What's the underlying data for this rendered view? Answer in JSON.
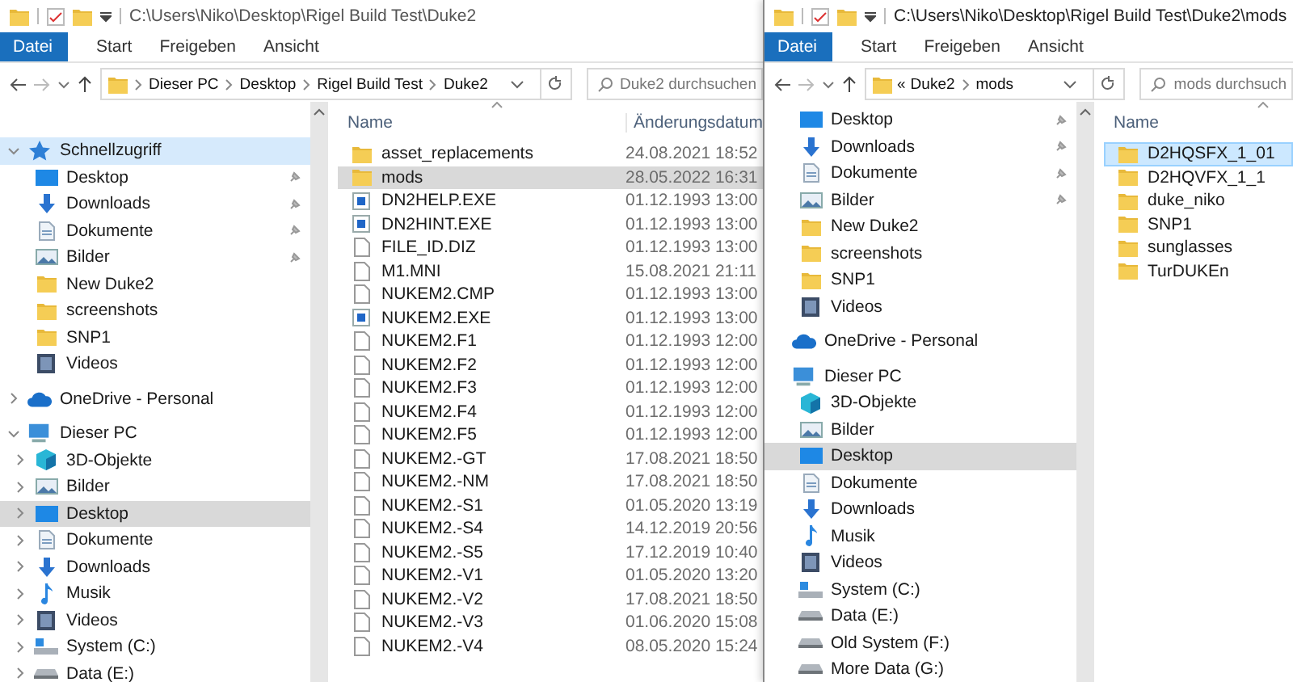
{
  "windows": [
    {
      "title_path": "C:\\Users\\Niko\\Desktop\\Rigel Build Test\\Duke2",
      "active": false,
      "chevrons_visible": true,
      "ribbon_tabs": [
        {
          "label": "Datei",
          "kind": "file_menu"
        },
        {
          "label": "Start",
          "kind": "tab"
        },
        {
          "label": "Freigeben",
          "kind": "tab"
        },
        {
          "label": "Ansicht",
          "kind": "tab"
        }
      ],
      "breadcrumb": {
        "segments": [
          "Dieser PC",
          "Desktop",
          "Rigel Build Test",
          "Duke2"
        ]
      },
      "search": {
        "placeholder": "Duke2 durchsuchen"
      },
      "sidebar": [
        {
          "label": "Schnellzugriff",
          "kind": "star",
          "expanded": true,
          "hovered": true,
          "children": [
            {
              "label": "Desktop",
              "kind": "desktop",
              "pinned": true,
              "selected": false
            },
            {
              "label": "Downloads",
              "kind": "downloads",
              "pinned": true,
              "selected": false
            },
            {
              "label": "Dokumente",
              "kind": "documents",
              "pinned": true,
              "selected": false
            },
            {
              "label": "Bilder",
              "kind": "pictures",
              "pinned": true,
              "selected": false
            },
            {
              "label": "New Duke2",
              "kind": "folder",
              "pinned": false,
              "selected": false
            },
            {
              "label": "screenshots",
              "kind": "folder",
              "pinned": false,
              "selected": false
            },
            {
              "label": "SNP1",
              "kind": "folder",
              "pinned": false,
              "selected": false
            },
            {
              "label": "Videos",
              "kind": "videos",
              "pinned": false,
              "selected": false
            }
          ]
        },
        {
          "label": "OneDrive - Personal",
          "kind": "cloud",
          "expanded": false,
          "hovered": false
        },
        {
          "label": "Dieser PC",
          "kind": "pc",
          "expanded": true,
          "hovered": false,
          "children": [
            {
              "label": "3D-Objekte",
              "kind": "objects3d",
              "pinned": false,
              "selected": false
            },
            {
              "label": "Bilder",
              "kind": "pictures",
              "pinned": false,
              "selected": false
            },
            {
              "label": "Desktop",
              "kind": "desktop",
              "pinned": false,
              "selected": true
            },
            {
              "label": "Dokumente",
              "kind": "documents",
              "pinned": false,
              "selected": false
            },
            {
              "label": "Downloads",
              "kind": "downloads",
              "pinned": false,
              "selected": false
            },
            {
              "label": "Musik",
              "kind": "music",
              "pinned": false,
              "selected": false
            },
            {
              "label": "Videos",
              "kind": "videos",
              "pinned": false,
              "selected": false
            },
            {
              "label": "System (C:)",
              "kind": "system_drive",
              "pinned": false,
              "selected": false
            },
            {
              "label": "Data (E:)",
              "kind": "drive",
              "pinned": false,
              "selected": false
            }
          ]
        }
      ],
      "columns": [
        "Name",
        "Änderungsdatum"
      ],
      "files": [
        {
          "name": "asset_replacements",
          "kind": "folder",
          "date": "24.08.2021 18:52",
          "selected": false
        },
        {
          "name": "mods",
          "kind": "folder",
          "date": "28.05.2022 16:31",
          "selected": true
        },
        {
          "name": "DN2HELP.EXE",
          "kind": "exe",
          "date": "01.12.1993 13:00",
          "selected": false
        },
        {
          "name": "DN2HINT.EXE",
          "kind": "exe",
          "date": "01.12.1993 13:00",
          "selected": false
        },
        {
          "name": "FILE_ID.DIZ",
          "kind": "file",
          "date": "01.12.1993 13:00",
          "selected": false
        },
        {
          "name": "M1.MNI",
          "kind": "file",
          "date": "15.08.2021 21:11",
          "selected": false
        },
        {
          "name": "NUKEM2.CMP",
          "kind": "file",
          "date": "01.12.1993 13:00",
          "selected": false
        },
        {
          "name": "NUKEM2.EXE",
          "kind": "exe",
          "date": "01.12.1993 13:00",
          "selected": false
        },
        {
          "name": "NUKEM2.F1",
          "kind": "file",
          "date": "01.12.1993 12:00",
          "selected": false
        },
        {
          "name": "NUKEM2.F2",
          "kind": "file",
          "date": "01.12.1993 12:00",
          "selected": false
        },
        {
          "name": "NUKEM2.F3",
          "kind": "file",
          "date": "01.12.1993 12:00",
          "selected": false
        },
        {
          "name": "NUKEM2.F4",
          "kind": "file",
          "date": "01.12.1993 12:00",
          "selected": false
        },
        {
          "name": "NUKEM2.F5",
          "kind": "file",
          "date": "01.12.1993 12:00",
          "selected": false
        },
        {
          "name": "NUKEM2.-GT",
          "kind": "file",
          "date": "17.08.2021 18:50",
          "selected": false
        },
        {
          "name": "NUKEM2.-NM",
          "kind": "file",
          "date": "17.08.2021 18:50",
          "selected": false
        },
        {
          "name": "NUKEM2.-S1",
          "kind": "file",
          "date": "01.05.2020 13:19",
          "selected": false
        },
        {
          "name": "NUKEM2.-S4",
          "kind": "file",
          "date": "14.12.2019 20:56",
          "selected": false
        },
        {
          "name": "NUKEM2.-S5",
          "kind": "file",
          "date": "17.12.2019 10:40",
          "selected": false
        },
        {
          "name": "NUKEM2.-V1",
          "kind": "file",
          "date": "01.05.2020 13:20",
          "selected": false
        },
        {
          "name": "NUKEM2.-V2",
          "kind": "file",
          "date": "17.08.2021 18:50",
          "selected": false
        },
        {
          "name": "NUKEM2.-V3",
          "kind": "file",
          "date": "01.06.2020 15:08",
          "selected": false
        },
        {
          "name": "NUKEM2.-V4",
          "kind": "file",
          "date": "08.05.2020 15:24",
          "selected": false
        }
      ]
    },
    {
      "title_path": "C:\\Users\\Niko\\Desktop\\Rigel Build Test\\Duke2\\mods",
      "active": true,
      "chevrons_visible": false,
      "ribbon_tabs": [
        {
          "label": "Datei",
          "kind": "file_menu"
        },
        {
          "label": "Start",
          "kind": "tab"
        },
        {
          "label": "Freigeben",
          "kind": "tab"
        },
        {
          "label": "Ansicht",
          "kind": "tab"
        }
      ],
      "breadcrumb": {
        "overflow_mark": "«",
        "segments": [
          "Duke2",
          "mods"
        ]
      },
      "search": {
        "placeholder": "mods durchsuch"
      },
      "sidebar": [
        {
          "expanded": true,
          "children": [
            {
              "label": "Desktop",
              "kind": "desktop",
              "pinned": true,
              "selected": false
            },
            {
              "label": "Downloads",
              "kind": "downloads",
              "pinned": true,
              "selected": false
            },
            {
              "label": "Dokumente",
              "kind": "documents",
              "pinned": true,
              "selected": false
            },
            {
              "label": "Bilder",
              "kind": "pictures",
              "pinned": true,
              "selected": false
            },
            {
              "label": "New Duke2",
              "kind": "folder",
              "pinned": false,
              "selected": false
            },
            {
              "label": "screenshots",
              "kind": "folder",
              "pinned": false,
              "selected": false
            },
            {
              "label": "SNP1",
              "kind": "folder",
              "pinned": false,
              "selected": false
            },
            {
              "label": "Videos",
              "kind": "videos",
              "pinned": false,
              "selected": false
            }
          ]
        },
        {
          "label": "OneDrive - Personal",
          "kind": "cloud",
          "hovered": false
        },
        {
          "label": "Dieser PC",
          "kind": "pc",
          "expanded": true,
          "hovered": false,
          "children": [
            {
              "label": "3D-Objekte",
              "kind": "objects3d",
              "pinned": false,
              "selected": false
            },
            {
              "label": "Bilder",
              "kind": "pictures",
              "pinned": false,
              "selected": false
            },
            {
              "label": "Desktop",
              "kind": "desktop",
              "pinned": false,
              "selected": true
            },
            {
              "label": "Dokumente",
              "kind": "documents",
              "pinned": false,
              "selected": false
            },
            {
              "label": "Downloads",
              "kind": "downloads",
              "pinned": false,
              "selected": false
            },
            {
              "label": "Musik",
              "kind": "music",
              "pinned": false,
              "selected": false
            },
            {
              "label": "Videos",
              "kind": "videos",
              "pinned": false,
              "selected": false
            },
            {
              "label": "System (C:)",
              "kind": "system_drive",
              "pinned": false,
              "selected": false
            },
            {
              "label": "Data (E:)",
              "kind": "drive",
              "pinned": false,
              "selected": false
            },
            {
              "label": "Old System (F:)",
              "kind": "drive",
              "pinned": false,
              "selected": false
            },
            {
              "label": "More Data (G:)",
              "kind": "drive",
              "pinned": false,
              "selected": false
            }
          ]
        }
      ],
      "columns": [
        "Name"
      ],
      "files": [
        {
          "name": "D2HQSFX_1_01",
          "kind": "folder",
          "selected": true
        },
        {
          "name": "D2HQVFX_1_1",
          "kind": "folder",
          "selected": false
        },
        {
          "name": "duke_niko",
          "kind": "folder",
          "selected": false
        },
        {
          "name": "SNP1",
          "kind": "folder",
          "selected": false
        },
        {
          "name": "sunglasses",
          "kind": "folder",
          "selected": false
        },
        {
          "name": "TurDUKEn",
          "kind": "folder",
          "selected": false
        }
      ]
    }
  ]
}
